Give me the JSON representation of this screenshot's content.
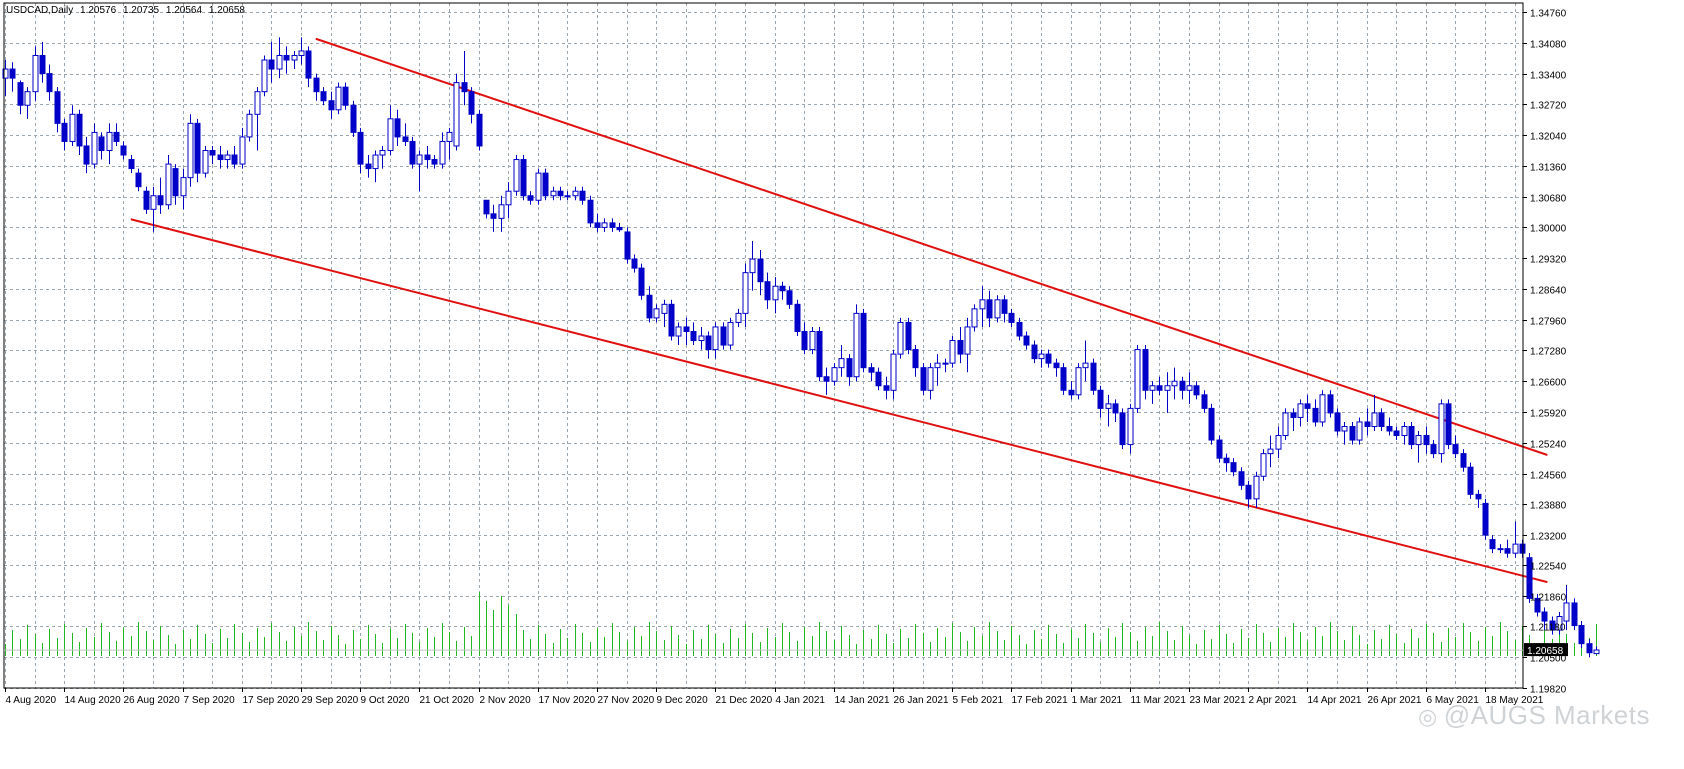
{
  "header": {
    "symbol_label": "USDCAD,Daily",
    "open": "1.20576",
    "high": "1.20735",
    "low": "1.20564",
    "close": "1.20658"
  },
  "watermark": {
    "icon": "weibo-icon",
    "text": "@AUGS Markets"
  },
  "colors": {
    "background": "#ffffff",
    "grid": "#9aa7b1",
    "candle": "#0000c8",
    "channel": "#e01010",
    "volume": "#22b822",
    "axis_text": "#000000"
  },
  "chart_data": {
    "type": "candlestick",
    "title": "USDCAD,Daily",
    "grid": true,
    "current_price": "1.20658",
    "y_axis": {
      "ylim": [
        1.1982,
        1.3496
      ],
      "tick_labels": [
        "1.34760",
        "1.34080",
        "1.33400",
        "1.32720",
        "1.32040",
        "1.31360",
        "1.30680",
        "1.30000",
        "1.29320",
        "1.28640",
        "1.27960",
        "1.27280",
        "1.26600",
        "1.25920",
        "1.25240",
        "1.24560",
        "1.23880",
        "1.23200",
        "1.22540",
        "1.21860",
        "1.21180",
        "1.20500",
        "1.19820"
      ],
      "tick_values": [
        1.3476,
        1.3408,
        1.334,
        1.3272,
        1.3204,
        1.3136,
        1.3068,
        1.3,
        1.2932,
        1.2864,
        1.2796,
        1.2728,
        1.266,
        1.2592,
        1.2524,
        1.2456,
        1.2388,
        1.232,
        1.2254,
        1.2186,
        1.2118,
        1.205,
        1.1982
      ]
    },
    "x_axis": {
      "tick_labels": [
        "4 Aug 2020",
        "14 Aug 2020",
        "26 Aug 2020",
        "7 Sep 2020",
        "17 Sep 2020",
        "29 Sep 2020",
        "9 Oct 2020",
        "21 Oct 2020",
        "2 Nov 2020",
        "17 Nov 2020",
        "27 Nov 2020",
        "9 Dec 2020",
        "21 Dec 2020",
        "4 Jan 2021",
        "14 Jan 2021",
        "26 Jan 2021",
        "5 Feb 2021",
        "17 Feb 2021",
        "1 Mar 2021",
        "11 Mar 2021",
        "23 Mar 2021",
        "2 Apr 2021",
        "14 Apr 2021",
        "26 Apr 2021",
        "6 May 2021",
        "18 May 2021"
      ],
      "tick_bar_index": [
        0,
        8,
        16,
        24,
        32,
        40,
        48,
        56,
        64,
        72,
        80,
        88,
        96,
        104,
        112,
        120,
        128,
        136,
        144,
        152,
        160,
        168,
        176,
        184,
        192,
        200
      ]
    },
    "channel_lines": [
      {
        "name": "upper",
        "start": {
          "date": "1 Oct 2020",
          "price": 1.3417
        },
        "end": {
          "date": "19 May 2021",
          "price": 1.2497
        }
      },
      {
        "name": "lower",
        "start": {
          "date": "27 Aug 2020",
          "price": 1.3018
        },
        "end": {
          "date": "19 May 2021",
          "price": 1.2216
        }
      }
    ],
    "candles": [
      [
        1.333,
        1.337,
        1.329,
        1.335
      ],
      [
        1.335,
        1.3365,
        1.33,
        1.333
      ],
      [
        1.332,
        1.3325,
        1.325,
        1.327
      ],
      [
        1.327,
        1.331,
        1.324,
        1.33
      ],
      [
        1.33,
        1.34,
        1.328,
        1.338
      ],
      [
        1.338,
        1.341,
        1.332,
        1.334
      ],
      [
        1.334,
        1.336,
        1.328,
        1.33
      ],
      [
        1.33,
        1.331,
        1.321,
        1.323
      ],
      [
        1.323,
        1.324,
        1.317,
        1.319
      ],
      [
        1.319,
        1.327,
        1.318,
        1.325
      ],
      [
        1.325,
        1.326,
        1.316,
        1.318
      ],
      [
        1.318,
        1.32,
        1.312,
        1.314
      ],
      [
        1.314,
        1.323,
        1.313,
        1.321
      ],
      [
        1.32,
        1.321,
        1.315,
        1.317
      ],
      [
        1.317,
        1.323,
        1.314,
        1.321
      ],
      [
        1.321,
        1.323,
        1.318,
        1.319
      ],
      [
        1.318,
        1.319,
        1.315,
        1.316
      ],
      [
        1.315,
        1.316,
        1.312,
        1.313
      ],
      [
        1.312,
        1.313,
        1.308,
        1.309
      ],
      [
        1.308,
        1.309,
        1.303,
        1.304
      ],
      [
        1.304,
        1.309,
        1.299,
        1.307
      ],
      [
        1.307,
        1.311,
        1.303,
        1.305
      ],
      [
        1.305,
        1.316,
        1.304,
        1.314
      ],
      [
        1.313,
        1.314,
        1.305,
        1.307
      ],
      [
        1.307,
        1.313,
        1.304,
        1.311
      ],
      [
        1.311,
        1.325,
        1.309,
        1.323
      ],
      [
        1.323,
        1.324,
        1.31,
        1.312
      ],
      [
        1.312,
        1.318,
        1.311,
        1.317
      ],
      [
        1.317,
        1.318,
        1.314,
        1.316
      ],
      [
        1.316,
        1.318,
        1.313,
        1.315
      ],
      [
        1.315,
        1.317,
        1.313,
        1.316
      ],
      [
        1.316,
        1.318,
        1.313,
        1.314
      ],
      [
        1.314,
        1.322,
        1.313,
        1.32
      ],
      [
        1.32,
        1.326,
        1.319,
        1.325
      ],
      [
        1.325,
        1.331,
        1.317,
        1.33
      ],
      [
        1.33,
        1.338,
        1.329,
        1.337
      ],
      [
        1.337,
        1.341,
        1.332,
        1.335
      ],
      [
        1.335,
        1.342,
        1.333,
        1.338
      ],
      [
        1.338,
        1.34,
        1.334,
        1.337
      ],
      [
        1.337,
        1.339,
        1.335,
        1.338
      ],
      [
        1.338,
        1.342,
        1.336,
        1.339
      ],
      [
        1.339,
        1.34,
        1.331,
        1.333
      ],
      [
        1.333,
        1.334,
        1.328,
        1.33
      ],
      [
        1.33,
        1.331,
        1.327,
        1.328
      ],
      [
        1.328,
        1.33,
        1.324,
        1.326
      ],
      [
        1.326,
        1.332,
        1.325,
        1.331
      ],
      [
        1.331,
        1.332,
        1.326,
        1.327
      ],
      [
        1.327,
        1.328,
        1.32,
        1.321
      ],
      [
        1.321,
        1.322,
        1.312,
        1.314
      ],
      [
        1.314,
        1.316,
        1.311,
        1.313
      ],
      [
        1.313,
        1.317,
        1.31,
        1.316
      ],
      [
        1.316,
        1.318,
        1.313,
        1.317
      ],
      [
        1.317,
        1.327,
        1.316,
        1.324
      ],
      [
        1.324,
        1.326,
        1.318,
        1.32
      ],
      [
        1.32,
        1.323,
        1.318,
        1.319
      ],
      [
        1.319,
        1.32,
        1.313,
        1.314
      ],
      [
        1.314,
        1.317,
        1.308,
        1.316
      ],
      [
        1.316,
        1.318,
        1.313,
        1.315
      ],
      [
        1.315,
        1.316,
        1.313,
        1.314
      ],
      [
        1.314,
        1.321,
        1.313,
        1.319
      ],
      [
        1.319,
        1.322,
        1.315,
        1.321
      ],
      [
        1.318,
        1.334,
        1.317,
        1.332
      ],
      [
        1.332,
        1.339,
        1.327,
        1.33
      ],
      [
        1.33,
        1.331,
        1.323,
        1.325
      ],
      [
        1.325,
        1.326,
        1.317,
        1.318
      ],
      [
        1.306,
        1.306,
        1.302,
        1.303
      ],
      [
        1.303,
        1.305,
        1.299,
        1.302
      ],
      [
        1.302,
        1.307,
        1.299,
        1.305
      ],
      [
        1.305,
        1.31,
        1.302,
        1.308
      ],
      [
        1.308,
        1.316,
        1.307,
        1.315
      ],
      [
        1.315,
        1.316,
        1.306,
        1.307
      ],
      [
        1.307,
        1.308,
        1.305,
        1.306
      ],
      [
        1.306,
        1.313,
        1.305,
        1.312
      ],
      [
        1.312,
        1.313,
        1.306,
        1.307
      ],
      [
        1.307,
        1.309,
        1.306,
        1.308
      ],
      [
        1.308,
        1.309,
        1.306,
        1.307
      ],
      [
        1.307,
        1.308,
        1.306,
        1.307
      ],
      [
        1.307,
        1.309,
        1.306,
        1.308
      ],
      [
        1.308,
        1.309,
        1.305,
        1.306
      ],
      [
        1.306,
        1.307,
        1.3,
        1.301
      ],
      [
        1.301,
        1.303,
        1.299,
        1.3
      ],
      [
        1.3,
        1.302,
        1.299,
        1.301
      ],
      [
        1.301,
        1.302,
        1.299,
        1.3
      ],
      [
        1.3,
        1.301,
        1.299,
        1.2995
      ],
      [
        1.299,
        1.3,
        1.292,
        1.293
      ],
      [
        1.293,
        1.294,
        1.29,
        1.291
      ],
      [
        1.291,
        1.292,
        1.284,
        1.285
      ],
      [
        1.285,
        1.287,
        1.279,
        1.28
      ],
      [
        1.28,
        1.283,
        1.279,
        1.282
      ],
      [
        1.281,
        1.284,
        1.278,
        1.283
      ],
      [
        1.283,
        1.284,
        1.275,
        1.276
      ],
      [
        1.276,
        1.279,
        1.274,
        1.278
      ],
      [
        1.278,
        1.28,
        1.274,
        1.277
      ],
      [
        1.277,
        1.279,
        1.274,
        1.275
      ],
      [
        1.275,
        1.278,
        1.273,
        1.276
      ],
      [
        1.276,
        1.277,
        1.271,
        1.273
      ],
      [
        1.273,
        1.279,
        1.271,
        1.278
      ],
      [
        1.278,
        1.279,
        1.273,
        1.274
      ],
      [
        1.274,
        1.28,
        1.273,
        1.279
      ],
      [
        1.279,
        1.282,
        1.278,
        1.281
      ],
      [
        1.281,
        1.292,
        1.278,
        1.29
      ],
      [
        1.29,
        1.297,
        1.286,
        1.293
      ],
      [
        1.293,
        1.295,
        1.285,
        1.288
      ],
      [
        1.288,
        1.29,
        1.282,
        1.284
      ],
      [
        1.284,
        1.289,
        1.281,
        1.287
      ],
      [
        1.287,
        1.288,
        1.284,
        1.286
      ],
      [
        1.286,
        1.287,
        1.282,
        1.283
      ],
      [
        1.283,
        1.284,
        1.276,
        1.277
      ],
      [
        1.277,
        1.279,
        1.272,
        1.273
      ],
      [
        1.273,
        1.278,
        1.272,
        1.277
      ],
      [
        1.277,
        1.278,
        1.266,
        1.267
      ],
      [
        1.267,
        1.269,
        1.263,
        1.266
      ],
      [
        1.266,
        1.27,
        1.265,
        1.269
      ],
      [
        1.269,
        1.274,
        1.267,
        1.271
      ],
      [
        1.271,
        1.272,
        1.265,
        1.267
      ],
      [
        1.267,
        1.283,
        1.266,
        1.281
      ],
      [
        1.281,
        1.282,
        1.268,
        1.269
      ],
      [
        1.269,
        1.27,
        1.266,
        1.268
      ],
      [
        1.268,
        1.269,
        1.264,
        1.265
      ],
      [
        1.265,
        1.267,
        1.262,
        1.264
      ],
      [
        1.264,
        1.273,
        1.262,
        1.272
      ],
      [
        1.272,
        1.28,
        1.271,
        1.279
      ],
      [
        1.279,
        1.28,
        1.272,
        1.273
      ],
      [
        1.273,
        1.274,
        1.267,
        1.269
      ],
      [
        1.269,
        1.27,
        1.263,
        1.264
      ],
      [
        1.264,
        1.27,
        1.262,
        1.269
      ],
      [
        1.269,
        1.272,
        1.265,
        1.27
      ],
      [
        1.27,
        1.271,
        1.268,
        1.27
      ],
      [
        1.27,
        1.276,
        1.269,
        1.275
      ],
      [
        1.275,
        1.278,
        1.27,
        1.272
      ],
      [
        1.272,
        1.28,
        1.268,
        1.278
      ],
      [
        1.278,
        1.283,
        1.277,
        1.282
      ],
      [
        1.282,
        1.287,
        1.278,
        1.284
      ],
      [
        1.284,
        1.286,
        1.278,
        1.28
      ],
      [
        1.28,
        1.285,
        1.279,
        1.284
      ],
      [
        1.284,
        1.285,
        1.279,
        1.281
      ],
      [
        1.281,
        1.282,
        1.278,
        1.279
      ],
      [
        1.279,
        1.28,
        1.275,
        1.276
      ],
      [
        1.276,
        1.277,
        1.273,
        1.274
      ],
      [
        1.274,
        1.275,
        1.27,
        1.271
      ],
      [
        1.271,
        1.273,
        1.269,
        1.272
      ],
      [
        1.272,
        1.273,
        1.269,
        1.27
      ],
      [
        1.27,
        1.271,
        1.267,
        1.269
      ],
      [
        1.269,
        1.27,
        1.263,
        1.264
      ],
      [
        1.264,
        1.266,
        1.262,
        1.263
      ],
      [
        1.263,
        1.27,
        1.262,
        1.269
      ],
      [
        1.269,
        1.275,
        1.266,
        1.27
      ],
      [
        1.27,
        1.271,
        1.263,
        1.264
      ],
      [
        1.264,
        1.265,
        1.258,
        1.26
      ],
      [
        1.26,
        1.263,
        1.256,
        1.261
      ],
      [
        1.261,
        1.262,
        1.257,
        1.259
      ],
      [
        1.259,
        1.26,
        1.251,
        1.252
      ],
      [
        1.252,
        1.261,
        1.25,
        1.26
      ],
      [
        1.26,
        1.274,
        1.259,
        1.273
      ],
      [
        1.273,
        1.274,
        1.262,
        1.264
      ],
      [
        1.264,
        1.266,
        1.261,
        1.265
      ],
      [
        1.265,
        1.267,
        1.263,
        1.264
      ],
      [
        1.264,
        1.268,
        1.259,
        1.265
      ],
      [
        1.265,
        1.269,
        1.262,
        1.266
      ],
      [
        1.266,
        1.267,
        1.262,
        1.264
      ],
      [
        1.264,
        1.268,
        1.261,
        1.265
      ],
      [
        1.265,
        1.266,
        1.262,
        1.263
      ],
      [
        1.263,
        1.264,
        1.259,
        1.26
      ],
      [
        1.26,
        1.261,
        1.252,
        1.253
      ],
      [
        1.253,
        1.254,
        1.248,
        1.249
      ],
      [
        1.249,
        1.25,
        1.246,
        1.248
      ],
      [
        1.248,
        1.249,
        1.245,
        1.246
      ],
      [
        1.246,
        1.247,
        1.242,
        1.243
      ],
      [
        1.243,
        1.244,
        1.238,
        1.24
      ],
      [
        1.24,
        1.246,
        1.238,
        1.245
      ],
      [
        1.245,
        1.251,
        1.244,
        1.25
      ],
      [
        1.25,
        1.254,
        1.247,
        1.251
      ],
      [
        1.251,
        1.256,
        1.249,
        1.254
      ],
      [
        1.254,
        1.26,
        1.253,
        1.259
      ],
      [
        1.259,
        1.26,
        1.255,
        1.258
      ],
      [
        1.258,
        1.262,
        1.256,
        1.261
      ],
      [
        1.261,
        1.263,
        1.257,
        1.26
      ],
      [
        1.26,
        1.262,
        1.256,
        1.257
      ],
      [
        1.257,
        1.264,
        1.256,
        1.263
      ],
      [
        1.263,
        1.264,
        1.258,
        1.259
      ],
      [
        1.259,
        1.26,
        1.254,
        1.255
      ],
      [
        1.255,
        1.257,
        1.252,
        1.256
      ],
      [
        1.256,
        1.257,
        1.252,
        1.253
      ],
      [
        1.253,
        1.258,
        1.252,
        1.257
      ],
      [
        1.257,
        1.26,
        1.254,
        1.256
      ],
      [
        1.256,
        1.263,
        1.255,
        1.259
      ],
      [
        1.259,
        1.26,
        1.255,
        1.256
      ],
      [
        1.256,
        1.258,
        1.254,
        1.255
      ],
      [
        1.255,
        1.256,
        1.253,
        1.254
      ],
      [
        1.254,
        1.257,
        1.252,
        1.256
      ],
      [
        1.256,
        1.257,
        1.251,
        1.252
      ],
      [
        1.252,
        1.255,
        1.248,
        1.254
      ],
      [
        1.254,
        1.256,
        1.25,
        1.252
      ],
      [
        1.252,
        1.253,
        1.249,
        1.25
      ],
      [
        1.25,
        1.262,
        1.248,
        1.261
      ],
      [
        1.261,
        1.262,
        1.251,
        1.252
      ],
      [
        1.252,
        1.254,
        1.249,
        1.25
      ],
      [
        1.25,
        1.251,
        1.246,
        1.247
      ],
      [
        1.247,
        1.248,
        1.24,
        1.241
      ],
      [
        1.241,
        1.242,
        1.238,
        1.24
      ],
      [
        1.239,
        1.24,
        1.231,
        1.232
      ],
      [
        1.231,
        1.232,
        1.228,
        1.229
      ],
      [
        1.229,
        1.23,
        1.228,
        1.229
      ],
      [
        1.229,
        1.231,
        1.227,
        1.228
      ],
      [
        1.228,
        1.235,
        1.227,
        1.23
      ],
      [
        1.23,
        1.231,
        1.227,
        1.228
      ],
      [
        1.227,
        1.228,
        1.217,
        1.218
      ],
      [
        1.218,
        1.219,
        1.214,
        1.215
      ],
      [
        1.215,
        1.216,
        1.211,
        1.213
      ],
      [
        1.213,
        1.214,
        1.21,
        1.211
      ],
      [
        1.211,
        1.215,
        1.21,
        1.214
      ],
      [
        1.213,
        1.221,
        1.211,
        1.217
      ],
      [
        1.217,
        1.218,
        1.211,
        1.212
      ],
      [
        1.212,
        1.213,
        1.207,
        1.208
      ],
      [
        1.208,
        1.209,
        1.205,
        1.206
      ],
      [
        1.2058,
        1.2074,
        1.2056,
        1.2066
      ]
    ]
  }
}
